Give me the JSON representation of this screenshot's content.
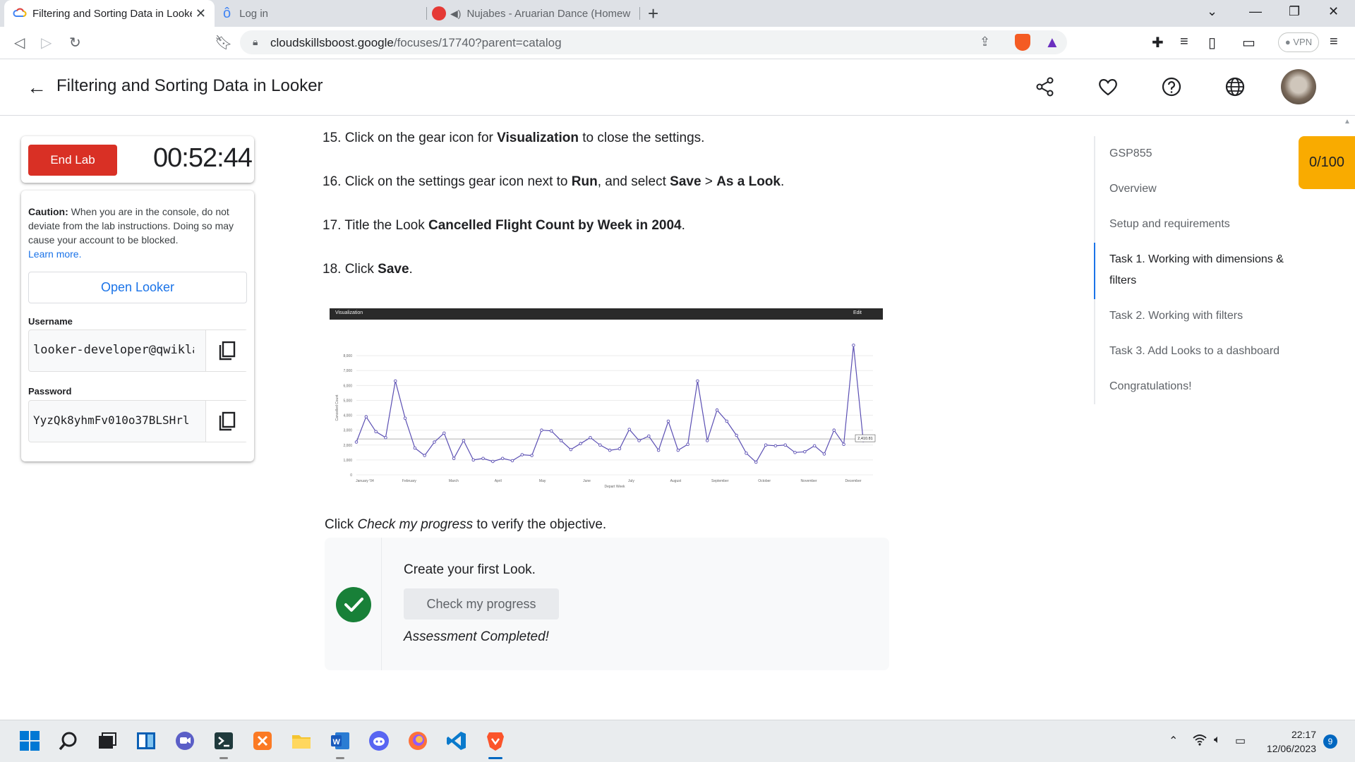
{
  "browser": {
    "tabs": [
      {
        "title": "Filtering and Sorting Data in Looker"
      },
      {
        "title": "Log in"
      },
      {
        "title": "Nujabes - Aruarian Dance (Homew"
      }
    ],
    "url_domain": "cloudskillsboost.google",
    "url_path": "/focuses/17740?parent=catalog",
    "vpn_label": "VPN"
  },
  "header": {
    "title": "Filtering and Sorting Data in Looker",
    "icons": [
      "share-icon",
      "heart-icon",
      "help-icon",
      "globe-icon"
    ]
  },
  "lab": {
    "end_label": "End Lab",
    "timer": "00:52:44",
    "caution_bold": "Caution:",
    "caution_text": " When you are in the console, do not deviate from the lab instructions. Doing so may cause your account to be blocked.",
    "learn_more": "Learn more.",
    "open_label": "Open Looker",
    "username_label": "Username",
    "username_value": "looker-developer@qwiklabs.com",
    "password_label": "Password",
    "password_value": "YyzQk8yhmFv010o37BLSHrl"
  },
  "steps": [
    {
      "num": "15.",
      "pre": "Click on the gear icon for ",
      "b1": "Visualization",
      "mid": " to close the settings.",
      "sep": "",
      "b2": "",
      "mid2": "",
      "b3": "",
      "post": ""
    },
    {
      "num": "16.",
      "pre": "Click on the settings gear icon next to ",
      "b1": "Run",
      "mid": ", and select ",
      "b2": "Save",
      "sep": " > ",
      "b3": "As a Look",
      "post": "."
    },
    {
      "num": "17.",
      "pre": "Title the Look ",
      "b1": "Cancelled Flight Count by Week in 2004",
      "mid": ".",
      "b2": "",
      "sep": "",
      "b3": "",
      "post": ""
    },
    {
      "num": "18.",
      "pre": "Click ",
      "b1": "Save",
      "mid": ".",
      "b2": "",
      "sep": "",
      "b3": "",
      "post": ""
    }
  ],
  "chart_data": {
    "type": "line",
    "title": "",
    "toolbar_label": "Visualization",
    "toolbar_edit": "Edit",
    "xlabel": "Depart Week",
    "ylabel": "Cancelled Count",
    "ylim": [
      0,
      9000
    ],
    "y_ticks": [
      "0",
      "1,000",
      "2,000",
      "3,000",
      "4,000",
      "5,000",
      "6,000",
      "7,000",
      "8,000"
    ],
    "x_ticks": [
      "January '04",
      "February",
      "March",
      "April",
      "May",
      "June",
      "July",
      "August",
      "September",
      "October",
      "November",
      "December"
    ],
    "reference_label": "2,410.81",
    "reference_value": 2410.81,
    "values": [
      2200,
      3900,
      2900,
      2500,
      6300,
      3800,
      1800,
      1300,
      2200,
      2800,
      1100,
      2300,
      1000,
      1100,
      900,
      1100,
      950,
      1350,
      1300,
      3000,
      2950,
      2300,
      1700,
      2100,
      2500,
      2000,
      1650,
      1750,
      3050,
      2300,
      2600,
      1650,
      3600,
      1650,
      2050,
      6300,
      2300,
      4350,
      3600,
      2650,
      1450,
      850,
      2000,
      1950,
      2000,
      1500,
      1550,
      1950,
      1400,
      3000,
      2050,
      8700,
      2300,
      2400
    ]
  },
  "check": {
    "line_pre": "Click ",
    "line_italic": "Check my progress",
    "line_post": " to verify the objective.",
    "title": "Create your first Look.",
    "button": "Check my progress",
    "status": "Assessment Completed!"
  },
  "toc": {
    "items": [
      "GSP855",
      "Overview",
      "Setup and requirements",
      "Task 1. Working with dimensions & filters",
      "Task 2. Working with filters",
      "Task 3. Add Looks to a dashboard",
      "Congratulations!"
    ],
    "score": "0/100"
  },
  "taskbar": {
    "time": "22:17",
    "date": "12/06/2023",
    "notifications": "9"
  },
  "colors": {
    "accent": "#1a73e8",
    "end_lab": "#d93025",
    "score": "#f9ab00",
    "success": "#188038"
  }
}
